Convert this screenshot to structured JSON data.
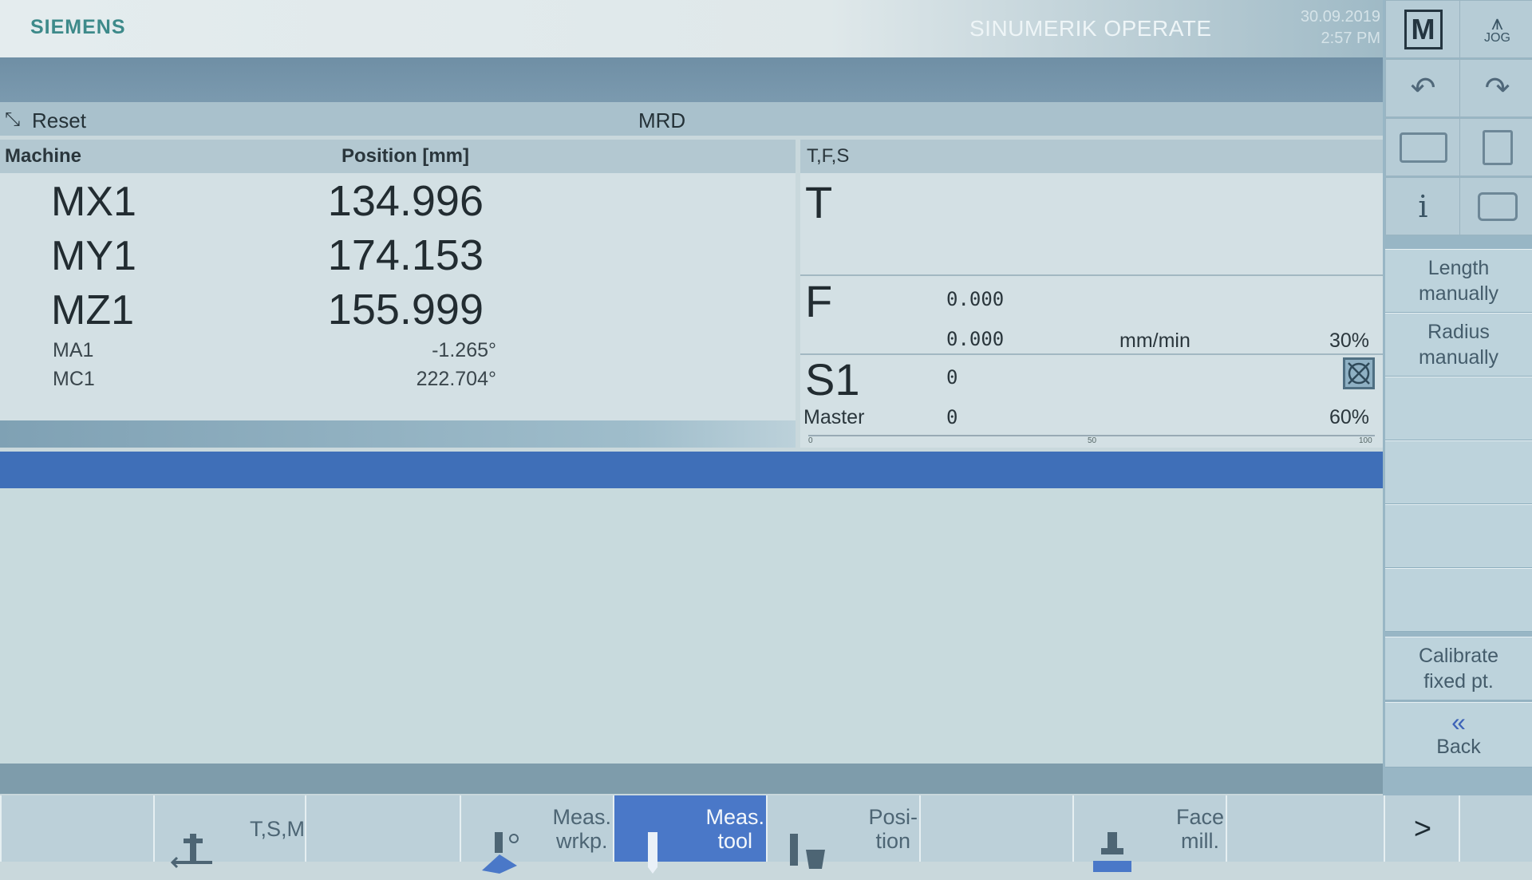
{
  "header": {
    "brand": "SIEMENS",
    "product": "SINUMERIK OPERATE",
    "date": "30.09.2019",
    "time": "2:57 PM"
  },
  "mode_buttons": {
    "machine": "M",
    "jog": "JOG"
  },
  "status": {
    "reset_label": "Reset",
    "mode": "MRD"
  },
  "axes": {
    "col_machine": "Machine",
    "col_position": "Position [mm]",
    "main": [
      {
        "name": "MX1",
        "value": "134.996"
      },
      {
        "name": "MY1",
        "value": "174.153"
      },
      {
        "name": "MZ1",
        "value": "155.999"
      }
    ],
    "rotary": [
      {
        "name": "MA1",
        "value": "-1.265°"
      },
      {
        "name": "MC1",
        "value": "222.704°"
      }
    ]
  },
  "tfs": {
    "title": "T,F,S",
    "t_label": "T",
    "f_label": "F",
    "f_value1": "0.000",
    "f_value2": "0.000",
    "f_unit": "mm/min",
    "f_override": "30%",
    "s_label": "S1",
    "s_value": "0",
    "master_label": "Master",
    "master_value": "0",
    "s_override": "60%",
    "scale": {
      "min": "0",
      "mid": "50",
      "max": "100"
    }
  },
  "vertical_softkeys": [
    {
      "label": "Length\nmanually"
    },
    {
      "label": "Radius\nmanually"
    },
    {
      "label": ""
    },
    {
      "label": ""
    },
    {
      "label": ""
    },
    {
      "label": ""
    },
    {
      "label": "Calibrate\nfixed pt."
    },
    {
      "label": "Back"
    }
  ],
  "horizontal_softkeys": [
    {
      "label": ""
    },
    {
      "label": "T,S,M"
    },
    {
      "label": ""
    },
    {
      "label": "Meas.\nwrkp."
    },
    {
      "label": "Meas.\ntool"
    },
    {
      "label": "Posi-\ntion"
    },
    {
      "label": ""
    },
    {
      "label": "Face\nmill."
    },
    {
      "label": ""
    },
    {
      "label": ">"
    }
  ],
  "colors": {
    "active_softkey": "#4a78c8",
    "blue_band": "#3f6fb8"
  }
}
